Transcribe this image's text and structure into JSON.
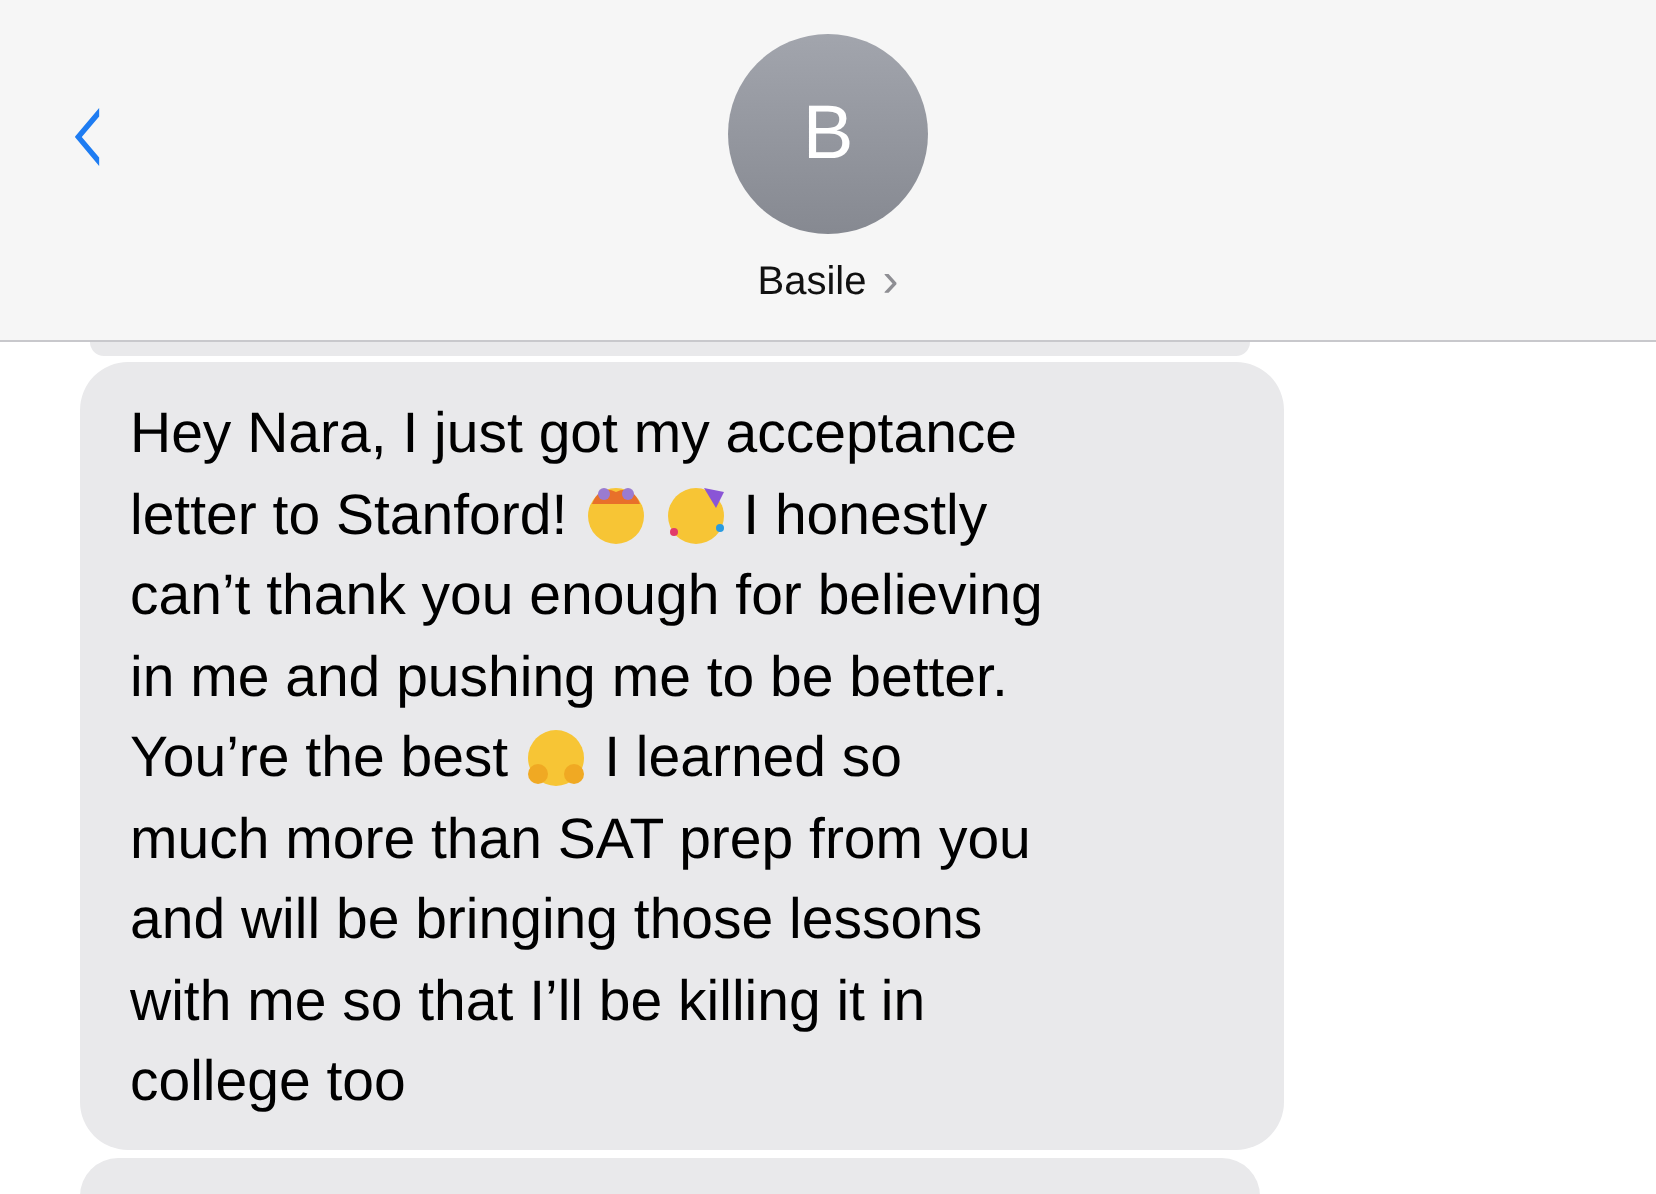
{
  "header": {
    "back": "‹",
    "avatar_initial": "B",
    "contact_name": "Basile",
    "contact_chevron": "›"
  },
  "messages": [
    {
      "kind": "partial-top"
    },
    {
      "kind": "full",
      "lines": [
        [
          {
            "kind": "text",
            "text": "Hey Nara, I just got my acceptance"
          }
        ],
        [
          {
            "kind": "text",
            "text": "letter to Stanford!"
          },
          {
            "kind": "exploding"
          },
          {
            "kind": "party"
          },
          {
            "kind": "text",
            "text": "I honestly"
          }
        ],
        [
          {
            "kind": "text",
            "text": "can’t thank you enough for believing"
          }
        ],
        [
          {
            "kind": "text",
            "text": "in me and pushing me to be better."
          }
        ],
        [
          {
            "kind": "text",
            "text": "You’re the best"
          },
          {
            "kind": "hug"
          },
          {
            "kind": "text",
            "text": "I learned so"
          }
        ],
        [
          {
            "kind": "text",
            "text": "much more than SAT prep from you"
          }
        ],
        [
          {
            "kind": "text",
            "text": "and will be bringing those lessons"
          }
        ],
        [
          {
            "kind": "text",
            "text": "with me so that I’ll be killing it in"
          }
        ],
        [
          {
            "kind": "text",
            "text": "college too"
          }
        ]
      ]
    },
    {
      "kind": "partial-bottom"
    }
  ]
}
